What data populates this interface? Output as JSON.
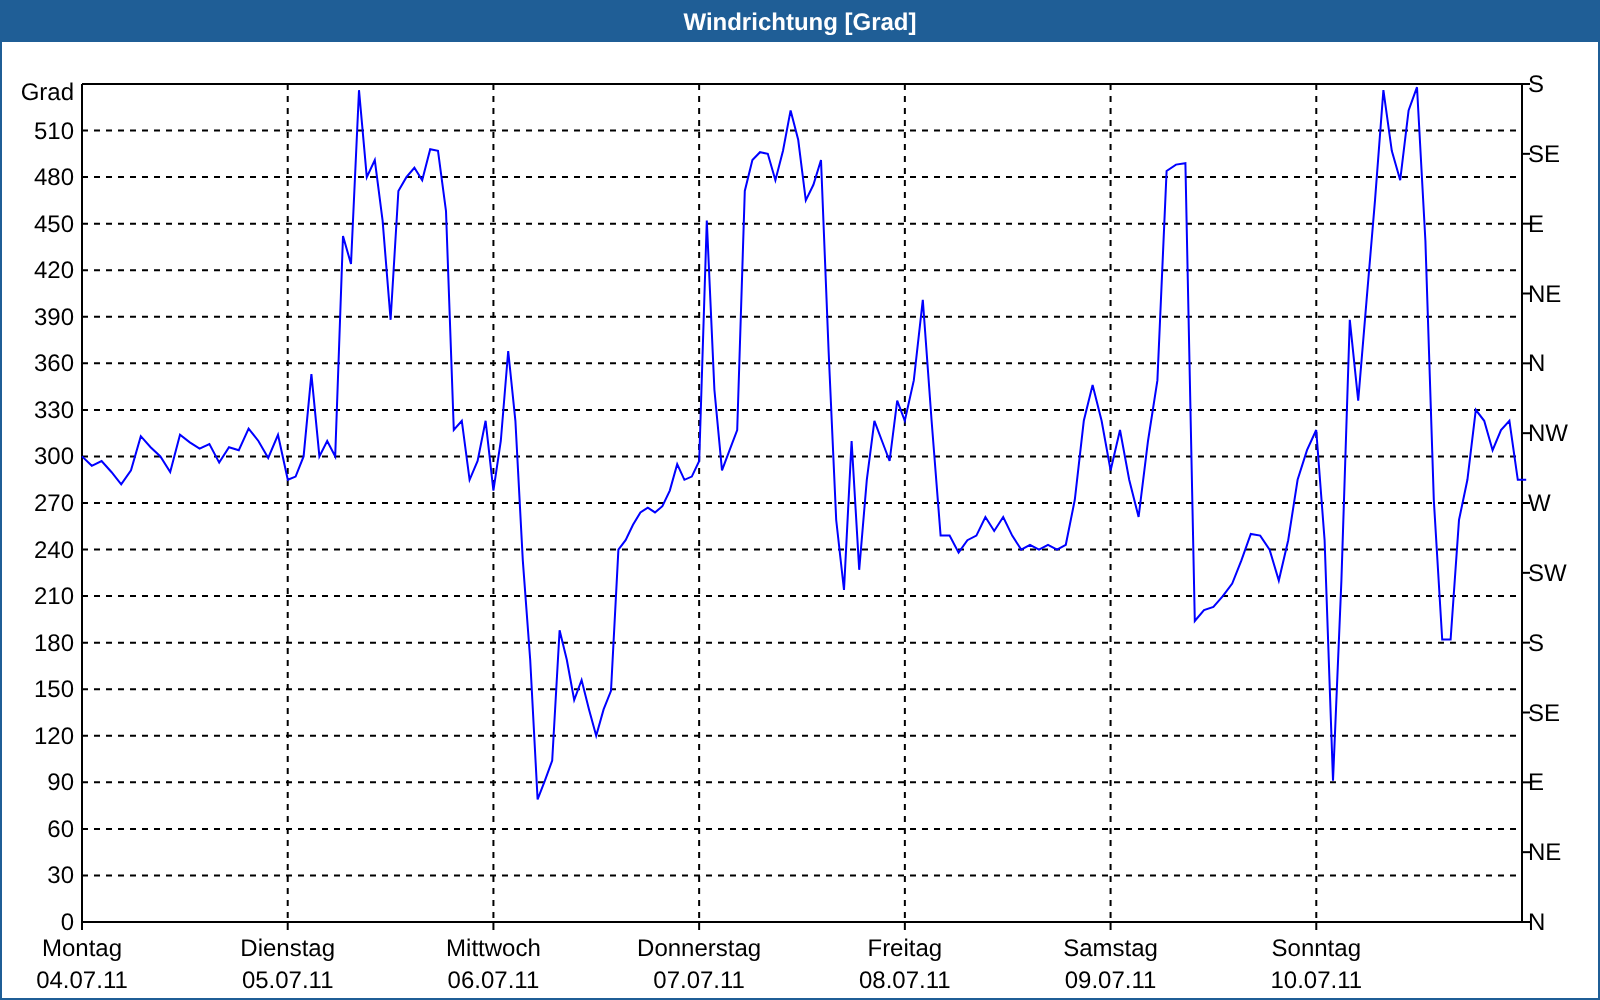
{
  "window": {
    "title": "Windrichtung [Grad]"
  },
  "chart": {
    "chart_data": {
      "type": "line",
      "grid": true,
      "ylabel": "Grad",
      "ylim": [
        0,
        540
      ],
      "yticks": [
        {
          "value": 0,
          "label": "0"
        },
        {
          "value": 30,
          "label": "30"
        },
        {
          "value": 60,
          "label": "60"
        },
        {
          "value": 90,
          "label": "90"
        },
        {
          "value": 120,
          "label": "120"
        },
        {
          "value": 150,
          "label": "150"
        },
        {
          "value": 180,
          "label": "180"
        },
        {
          "value": 210,
          "label": "210"
        },
        {
          "value": 240,
          "label": "240"
        },
        {
          "value": 270,
          "label": "270"
        },
        {
          "value": 300,
          "label": "300"
        },
        {
          "value": 330,
          "label": "330"
        },
        {
          "value": 360,
          "label": "360"
        },
        {
          "value": 390,
          "label": "390"
        },
        {
          "value": 420,
          "label": "420"
        },
        {
          "value": 450,
          "label": "450"
        },
        {
          "value": 480,
          "label": "480"
        },
        {
          "value": 510,
          "label": "510"
        }
      ],
      "categories": [
        "04.07.11",
        null,
        null,
        null,
        null,
        null,
        null,
        null,
        null,
        null,
        null,
        null,
        null,
        null,
        null,
        null,
        null,
        null,
        null,
        null,
        null,
        "05.07.11",
        null,
        null,
        null,
        null,
        null,
        null,
        null,
        null,
        null,
        null,
        null,
        null,
        null,
        null,
        null,
        null,
        null,
        null,
        null,
        null,
        null,
        null,
        null,
        null,
        null,
        "06.07.11",
        null,
        null,
        null,
        null,
        null,
        null,
        null,
        null,
        null,
        null,
        null,
        null,
        null,
        null,
        null,
        null,
        null,
        null,
        null,
        null,
        null,
        null,
        null,
        null,
        null,
        null,
        null,
        "07.07.11",
        null,
        null,
        null,
        null,
        null,
        null,
        null,
        null,
        null,
        null,
        null,
        null,
        null,
        null,
        null,
        null,
        null,
        null,
        null,
        null,
        null,
        null,
        null,
        null,
        null,
        null,
        "08.07.11",
        null,
        null,
        null,
        null,
        null,
        null,
        null,
        null,
        null,
        null,
        null,
        null,
        null,
        null,
        null,
        null,
        null,
        null,
        null,
        null,
        null,
        null,
        "09.07.11",
        null,
        null,
        null,
        null,
        null,
        null,
        null,
        null,
        null,
        null,
        null,
        null,
        null,
        null,
        null,
        null,
        null,
        null,
        null,
        null,
        null,
        "10.07.11",
        null,
        null,
        null,
        null,
        null,
        null,
        null,
        null,
        null,
        null,
        null,
        null,
        null,
        null,
        null,
        null,
        null,
        null,
        null,
        null,
        null,
        null,
        null,
        null,
        null
      ],
      "series": [
        {
          "color": "#0000ff",
          "values": [
            300,
            294,
            297,
            290,
            282,
            291,
            313,
            306,
            300,
            290,
            314,
            309,
            305,
            308,
            296,
            306,
            304,
            318,
            310,
            299,
            314,
            285,
            287,
            300,
            353,
            300,
            310,
            300,
            442,
            424,
            536,
            480,
            491,
            452,
            388,
            471,
            480,
            486,
            478,
            498,
            497,
            458,
            317,
            323,
            285,
            297,
            323,
            278,
            310,
            368,
            323,
            233,
            169,
            79,
            91,
            104,
            188,
            169,
            143,
            156,
            137,
            120,
            137,
            149,
            240,
            246,
            256,
            264,
            267,
            264,
            268,
            278,
            295,
            285,
            287,
            297,
            452,
            343,
            291,
            304,
            317,
            471,
            491,
            496,
            495,
            478,
            497,
            523,
            504,
            465,
            475,
            491,
            368,
            259,
            214,
            310,
            227,
            285,
            323,
            310,
            297,
            336,
            323,
            349,
            401,
            323,
            249,
            249,
            238,
            246,
            249,
            261,
            252,
            261,
            249,
            240,
            243,
            240,
            243,
            240,
            243,
            272,
            323,
            346,
            323,
            291,
            317,
            285,
            261,
            310,
            349,
            484,
            488,
            489,
            194,
            201,
            203,
            210,
            218,
            233,
            250,
            249,
            240,
            220,
            246,
            285,
            304,
            317,
            246,
            91,
            220,
            388,
            336,
            401,
            465,
            536,
            497,
            478,
            523,
            538,
            439,
            272,
            182,
            182,
            259,
            285,
            330,
            323,
            304,
            317,
            323,
            285,
            285
          ]
        }
      ]
    },
    "weekdays": [
      "Montag",
      "Dienstag",
      "Mittwoch",
      "Donnerstag",
      "Freitag",
      "Samstag",
      "Sonntag"
    ],
    "right_axis": [
      "S",
      "SE",
      "E",
      "NE",
      "N",
      "NW",
      "W",
      "SW",
      "S",
      "SE",
      "E",
      "NE",
      "N"
    ]
  }
}
